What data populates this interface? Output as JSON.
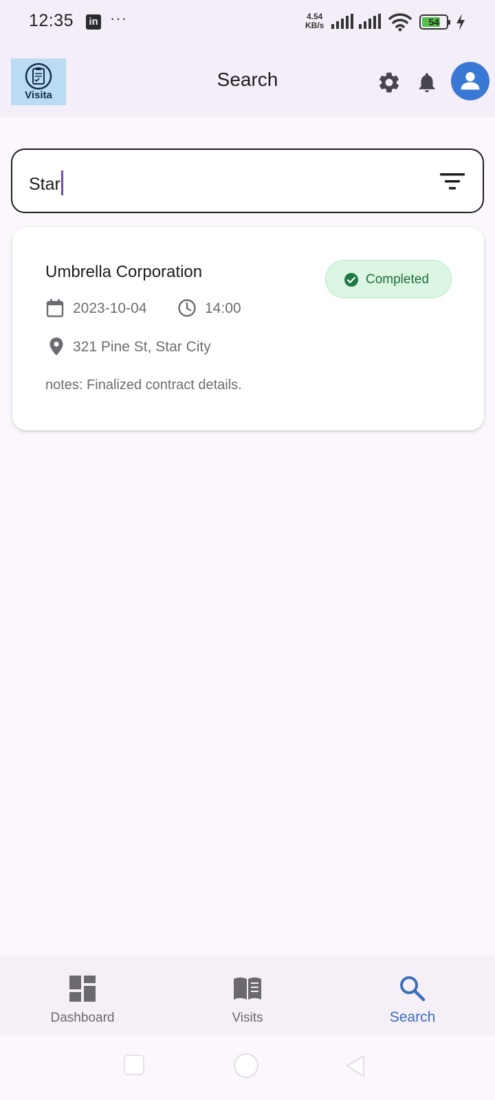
{
  "status_bar": {
    "time": "12:35",
    "linkedin_glyph": "in",
    "more": "···",
    "net_speed_value": "4.54",
    "net_speed_unit": "KB/s",
    "battery": "54"
  },
  "app_bar": {
    "logo_text": "Visita",
    "title": "Search",
    "icons": [
      "settings-icon",
      "bell-icon",
      "account-icon"
    ]
  },
  "search": {
    "value": "Star"
  },
  "results": [
    {
      "title": "Umbrella Corporation",
      "status": "Completed",
      "date": "2023-10-04",
      "time": "14:00",
      "address": "321 Pine St, Star City",
      "notes": "notes: Finalized contract details."
    }
  ],
  "bottom_nav": {
    "items": [
      {
        "label": "Dashboard",
        "icon": "dashboard-icon",
        "active": false
      },
      {
        "label": "Visits",
        "icon": "book-icon",
        "active": false
      },
      {
        "label": "Search",
        "icon": "search-icon",
        "active": true
      }
    ]
  },
  "colors": {
    "accent": "#3a78d6",
    "active_nav": "#3d6fb8",
    "status_completed_bg": "#dcf6e4",
    "status_completed_text": "#1e6b3c",
    "caret": "#6f4bb2"
  }
}
